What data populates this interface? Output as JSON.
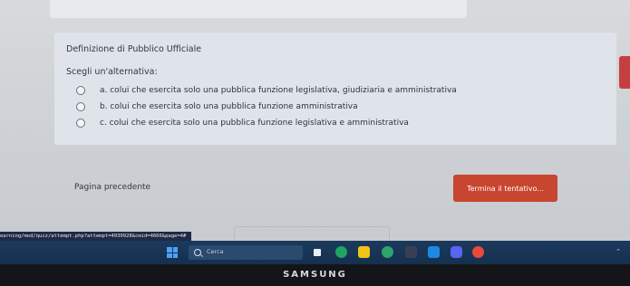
{
  "question": {
    "title": "Definizione di Pubblico Ufficiale",
    "prompt": "Scegli un'alternativa:",
    "answers": [
      {
        "label": "a. colui che esercita solo una pubblica funzione legislativa, giudiziaria e amministrativa",
        "selected": false
      },
      {
        "label": "b. colui che esercita solo una pubblica funzione amministrativa",
        "selected": false
      },
      {
        "label": "c. colui che esercita solo una pubblica funzione legislativa e amministrativa",
        "selected": false
      }
    ]
  },
  "navigation": {
    "prev_label": "Pagina precedente",
    "finish_label": "Termina il tentativo..."
  },
  "status_url": "earning/mod/quiz/attempt.php?attempt=4030928&cmid=4666&page=4#",
  "taskbar": {
    "search_placeholder": "Cerca"
  },
  "monitor_brand": "SAMSUNG",
  "colors": {
    "finish_button": "#c8452f",
    "question_card": "#dfe4ea",
    "taskbar": "#1b3a5c"
  }
}
